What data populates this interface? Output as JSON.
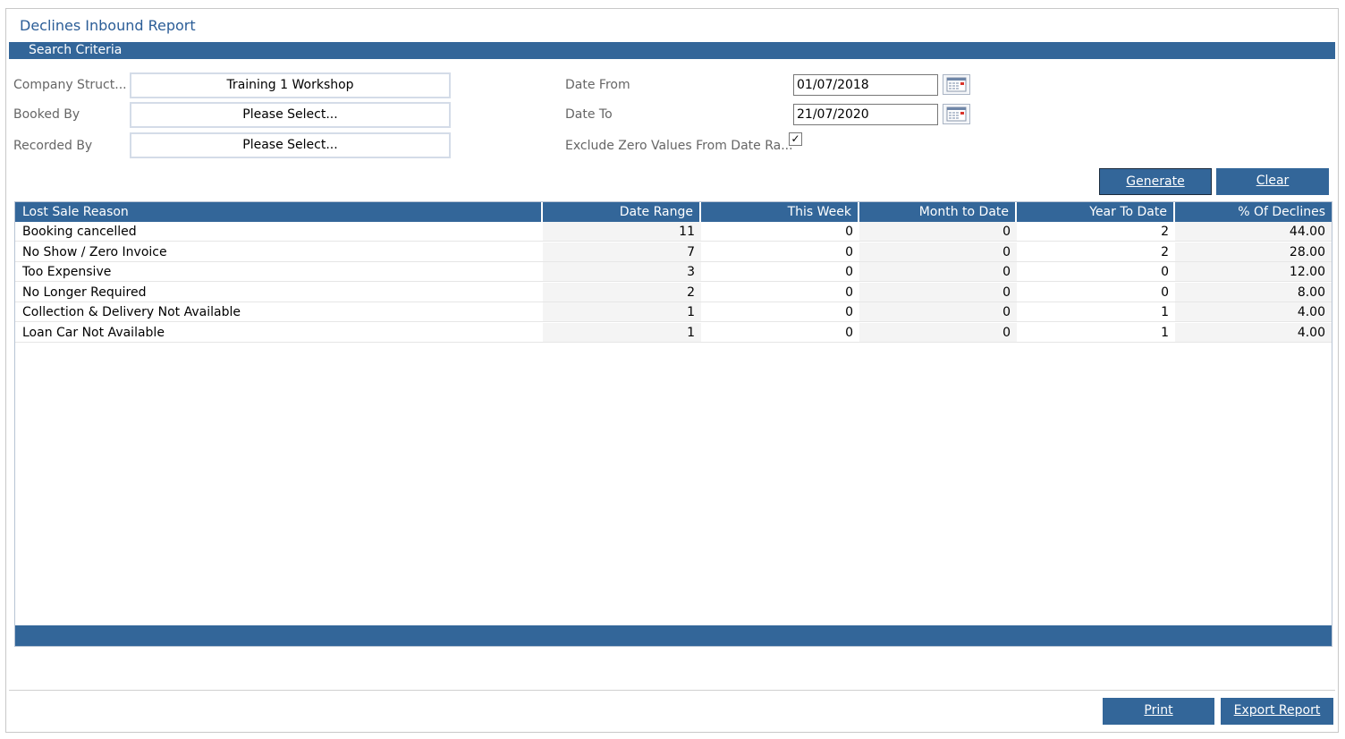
{
  "page": {
    "title": "Declines Inbound Report"
  },
  "search": {
    "section_title": "Search Criteria",
    "company_structure": {
      "label": "Company Struct...",
      "value": "Training 1 Workshop"
    },
    "booked_by": {
      "label": "Booked By",
      "value": "Please Select..."
    },
    "recorded_by": {
      "label": "Recorded By",
      "value": "Please Select..."
    },
    "date_from": {
      "label": "Date From",
      "value": "01/07/2018",
      "icon": "calendar-icon"
    },
    "date_to": {
      "label": "Date To",
      "value": "21/07/2020",
      "icon": "calendar-icon"
    },
    "exclude_zero": {
      "label": "Exclude Zero Values From Date Ra...",
      "checked": true,
      "glyph": "✓"
    }
  },
  "actions": {
    "generate": "Generate",
    "clear": "Clear",
    "print": "Print",
    "export": "Export Report"
  },
  "table": {
    "columns": [
      "Lost Sale Reason",
      "Date Range",
      "This Week",
      "Month to Date",
      "Year To Date",
      "% Of Declines"
    ],
    "rows": [
      [
        "Booking cancelled",
        "11",
        "0",
        "0",
        "2",
        "44.00"
      ],
      [
        "No Show / Zero Invoice",
        "7",
        "0",
        "0",
        "2",
        "28.00"
      ],
      [
        "Too Expensive",
        "3",
        "0",
        "0",
        "0",
        "12.00"
      ],
      [
        "No Longer Required",
        "2",
        "0",
        "0",
        "0",
        "8.00"
      ],
      [
        "Collection & Delivery Not Available",
        "1",
        "0",
        "0",
        "1",
        "4.00"
      ],
      [
        "Loan Car Not Available",
        "1",
        "0",
        "0",
        "1",
        "4.00"
      ]
    ]
  },
  "colors": {
    "accent": "#336699",
    "title": "#2b5d97",
    "label": "#666666"
  }
}
